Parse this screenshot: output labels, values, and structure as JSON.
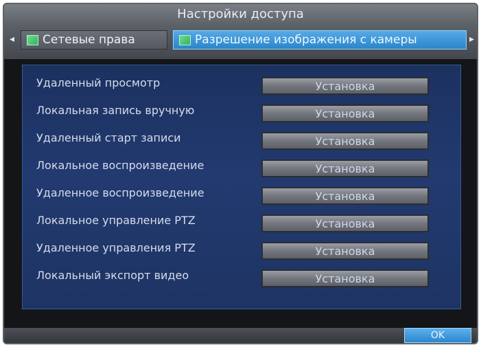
{
  "window": {
    "title": "Настройки доступа"
  },
  "tabs": [
    {
      "label": "Сетевые права",
      "icon": "green-flag-icon",
      "active": false
    },
    {
      "label": "Разрешение изображения с камеры",
      "icon": "green-flag-icon",
      "active": true
    }
  ],
  "nav": {
    "left_arrow": "◂",
    "right_arrow": "▸"
  },
  "rows": [
    {
      "label": "Удаленный просмотр",
      "button": "Установка"
    },
    {
      "label": "Локальная запись вручную",
      "button": "Установка"
    },
    {
      "label": "Удаленный старт записи",
      "button": "Установка"
    },
    {
      "label": "Локальное воспроизведение",
      "button": "Установка"
    },
    {
      "label": "Удаленное воспроизведение",
      "button": "Установка"
    },
    {
      "label": "Локальное управление PTZ",
      "button": "Установка"
    },
    {
      "label": "Удаленное управления PTZ",
      "button": "Установка"
    },
    {
      "label": "Локальный экспорт видео",
      "button": "Установка"
    }
  ],
  "footer": {
    "ok_label": "OK"
  },
  "colors": {
    "panel_bg": "#223a70",
    "active_tab": "#3c96d8",
    "button": "#7d8187",
    "frame": "#131518"
  }
}
